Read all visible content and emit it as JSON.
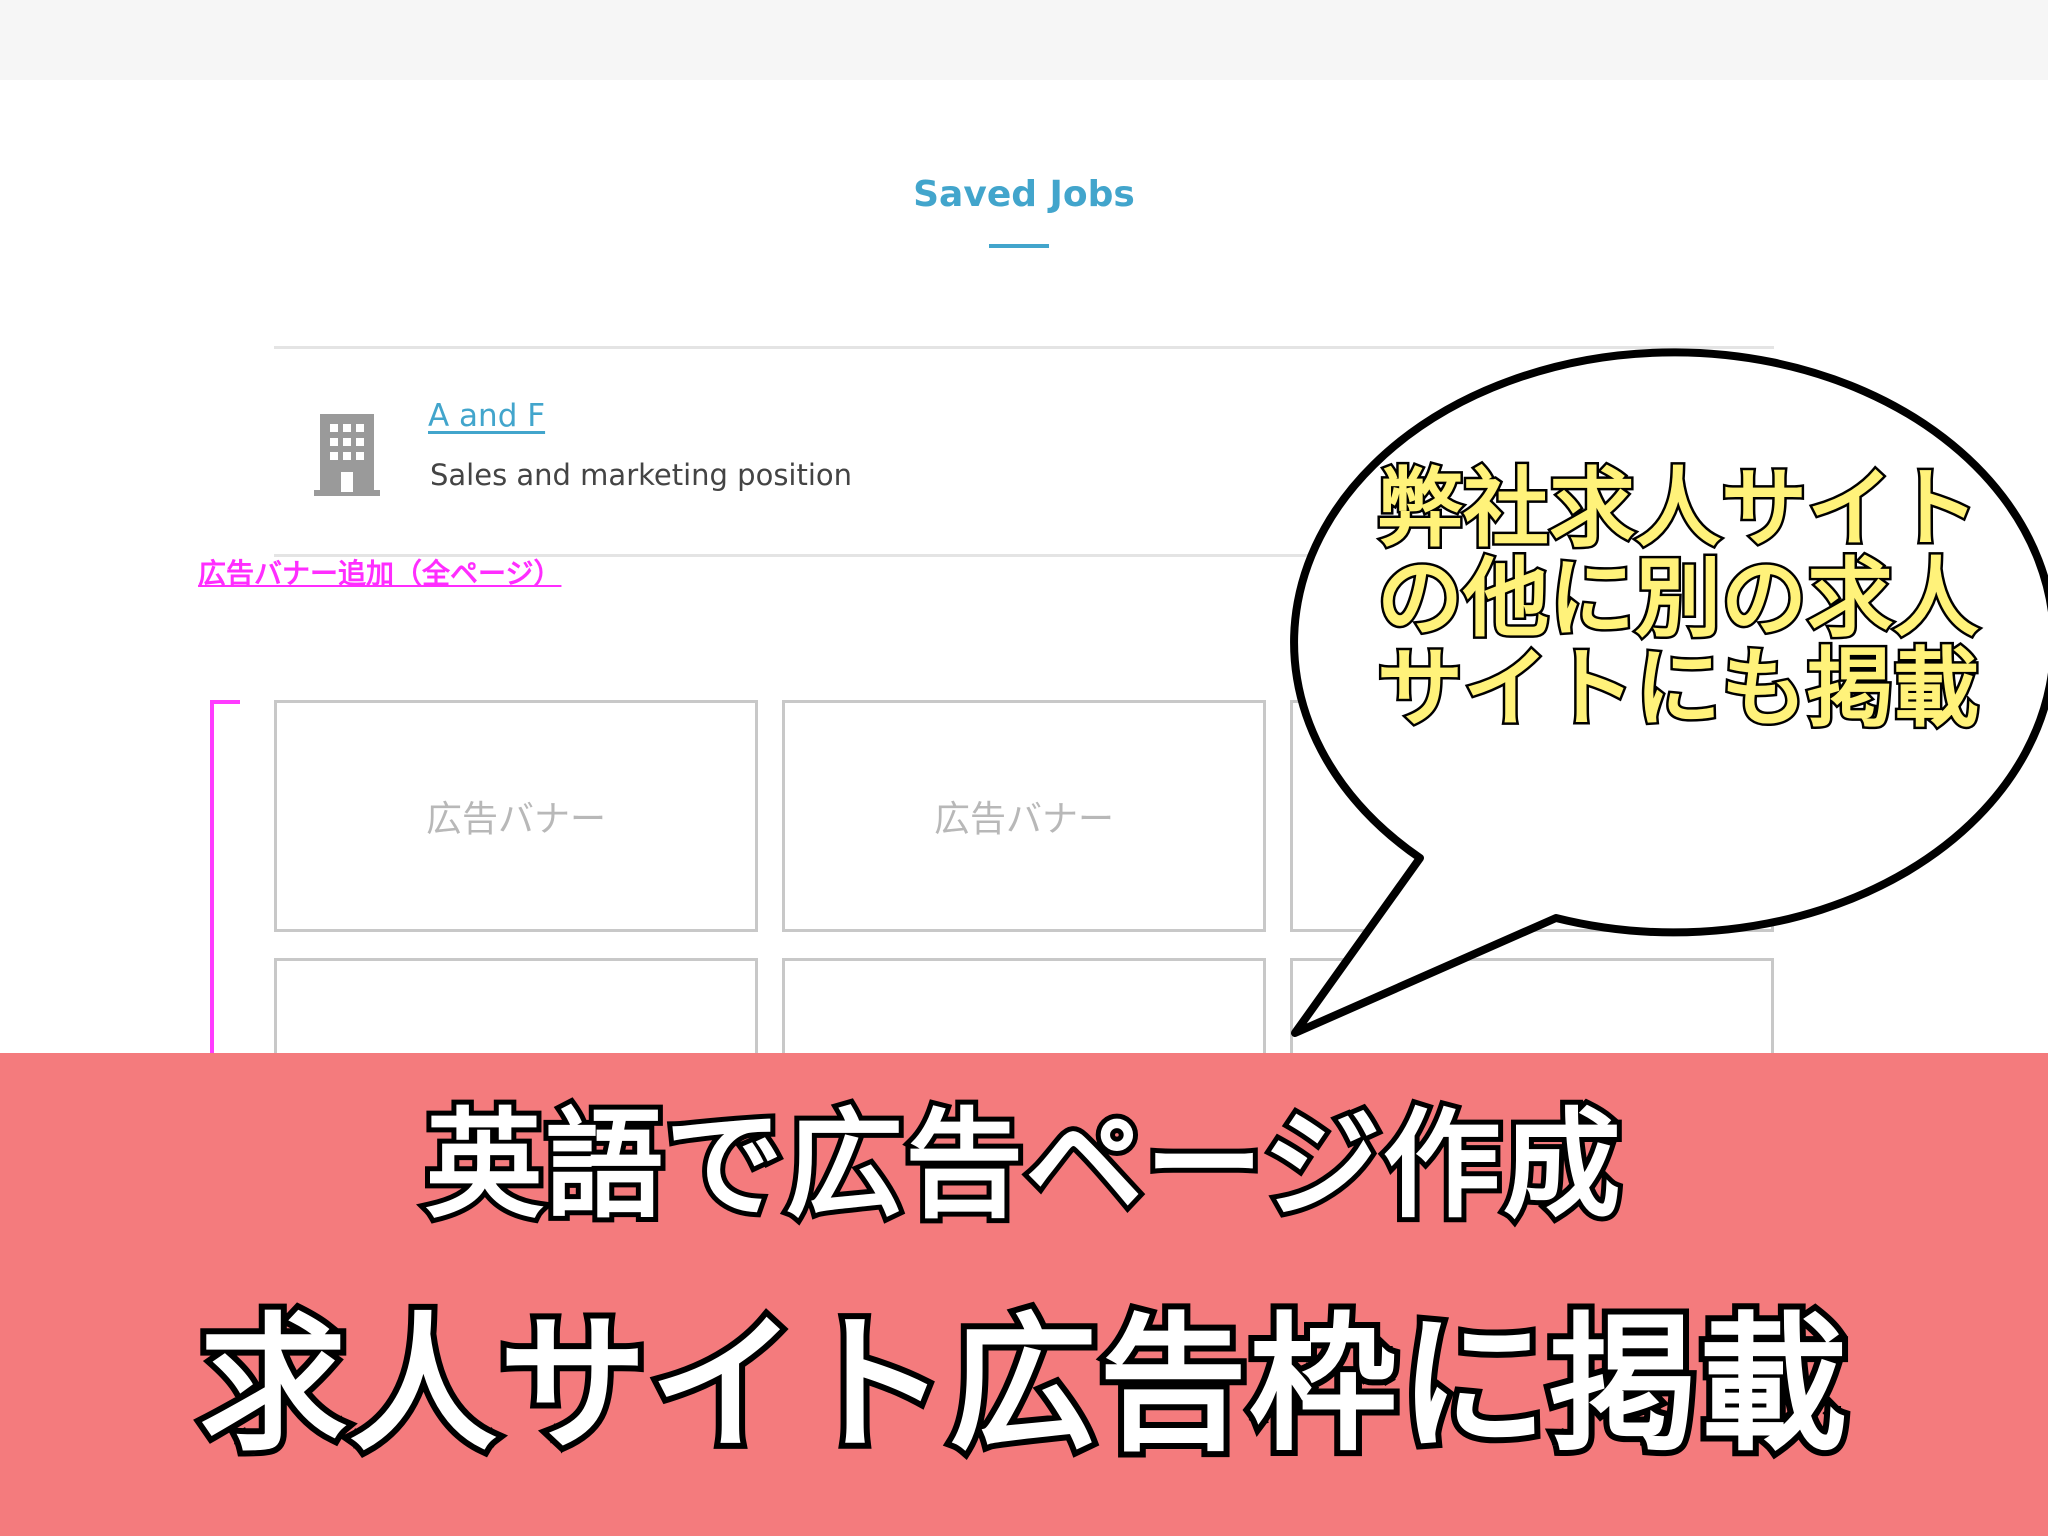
{
  "header": {
    "title": "Saved Jobs"
  },
  "job": {
    "company": "A and F",
    "description": "Sales and marketing position",
    "icon": "building-icon"
  },
  "ad_section": {
    "add_link": "広告バナー追加（全ページ）",
    "banners": [
      "広告バナー",
      "広告バナー",
      "",
      "",
      "",
      ""
    ]
  },
  "callout": {
    "lines": [
      "弊社求人サイト",
      "の他に別の求人",
      "サイトにも掲載"
    ]
  },
  "caption": {
    "line1": "英語で広告ページ作成",
    "line2": "求人サイト広告枠に掲載"
  },
  "colors": {
    "accent": "#42a5cc",
    "ad_link": "#ff2dff",
    "callout_text": "#fff27a",
    "caption_bg": "#f47b7d"
  }
}
